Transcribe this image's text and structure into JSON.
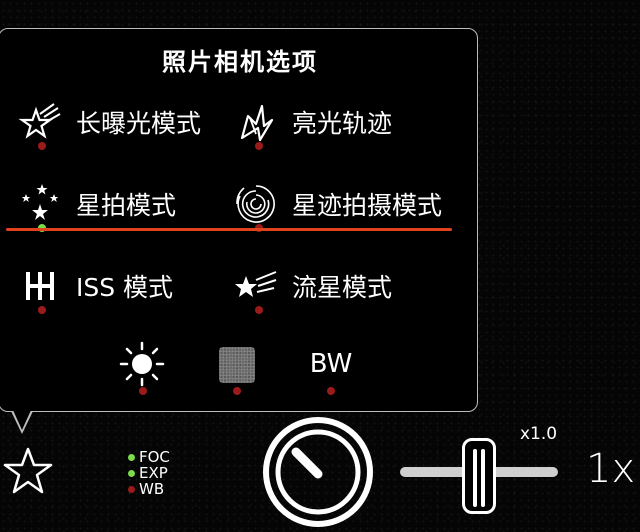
{
  "panel": {
    "title": "照片相机选项",
    "modes": [
      {
        "label": "长曝光模式",
        "icon": "long-exposure-star-icon",
        "active": false
      },
      {
        "label": "亮光轨迹",
        "icon": "light-trail-icon",
        "active": false
      },
      {
        "label": "星拍模式",
        "icon": "stars-icon",
        "active": true
      },
      {
        "label": "星迹拍摄模式",
        "icon": "star-trail-spiral-icon",
        "active": false
      },
      {
        "label": "ISS 模式",
        "icon": "iss-icon",
        "active": false
      },
      {
        "label": "流星模式",
        "icon": "meteor-icon",
        "active": false
      }
    ],
    "filters": [
      {
        "name": "brightness-sun-icon",
        "label": ""
      },
      {
        "name": "noise-gray-swatch-icon",
        "label": ""
      },
      {
        "name": "bw-filter",
        "label": "BW"
      }
    ]
  },
  "status": {
    "items": [
      {
        "label": "FOC",
        "color": "#7ddc4c"
      },
      {
        "label": "EXP",
        "color": "#7ddc4c"
      },
      {
        "label": "WB",
        "color": "#9b1a1a"
      }
    ]
  },
  "zoom": {
    "level_label": "x1.0",
    "value_label": "1x"
  },
  "colors": {
    "accent_line": "#e0421e",
    "active_dot": "#7ddc4c",
    "inactive_dot": "#9b1a1a"
  }
}
